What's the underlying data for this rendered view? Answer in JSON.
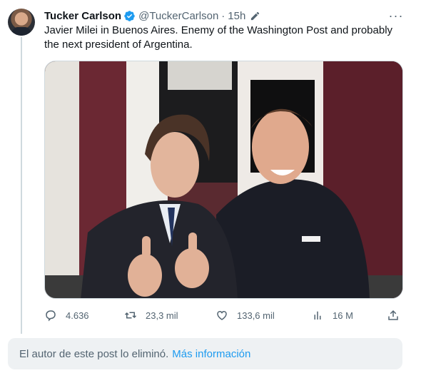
{
  "tweet": {
    "author_name": "Tucker Carlson",
    "handle": "@TuckerCarlson",
    "separator": "·",
    "time": "15h",
    "text": "Javier Milei in Buenos Aires. Enemy of the Washington Post and probably the next president of Argentina.",
    "more_label": "···"
  },
  "stats": {
    "replies": "4.636",
    "reposts": "23,3 mil",
    "likes": "133,6 mil",
    "views": "16 M"
  },
  "notice": {
    "text": "El autor de este post lo eliminó.",
    "link": "Más información"
  },
  "colors": {
    "accent": "#1d9bf0",
    "secondary_text": "#536471",
    "notice_bg": "#eef1f3"
  },
  "icons": [
    "verified-badge-icon",
    "edit-icon",
    "more-icon",
    "reply-icon",
    "repost-icon",
    "like-icon",
    "views-icon",
    "share-icon"
  ]
}
